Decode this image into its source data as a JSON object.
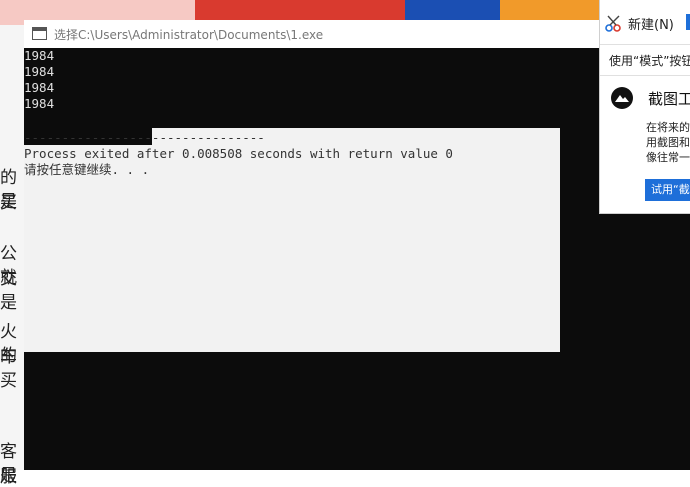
{
  "background": {
    "side_texts": [
      "的买",
      "是",
      "公交",
      "就是",
      "火车",
      "的买",
      "客服",
      "是"
    ]
  },
  "window": {
    "title": "选择C:\\Users\\Administrator\\Documents\\1.exe"
  },
  "console": {
    "output_lines": [
      "1984",
      "1984",
      "1984",
      "1984"
    ],
    "separator": "--------------------------------",
    "process_line": "Process exited after 0.008508 seconds with return value 0",
    "prompt_line": "请按任意键继续. . ."
  },
  "snipping_tool": {
    "new_button": "新建(N)",
    "mode_hint": "使用“模式”按钮",
    "app_title": "截图工",
    "notice_lines": [
      "在将来的",
      "用截图和",
      "像往常一"
    ],
    "try_button": "试用“截"
  },
  "colors": {
    "console_bg": "#0c0c0c",
    "selection_bg": "#f2f2f2",
    "accent_blue": "#1e6fd9"
  }
}
